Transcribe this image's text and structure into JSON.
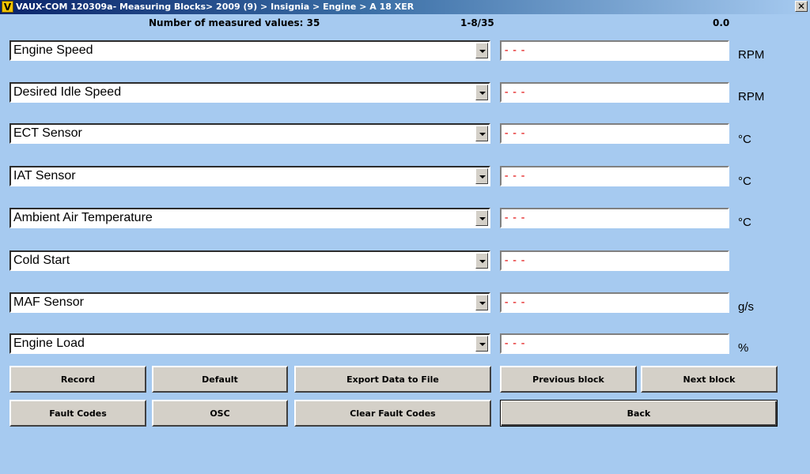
{
  "window": {
    "icon_letter": "V",
    "title": "VAUX-COM 120309a- Measuring Blocks> 2009 (9) > Insignia > Engine > A 18 XER",
    "close_symbol": "✕"
  },
  "header": {
    "count_label": "Number of measured values: 35",
    "range": "1-8/35",
    "time": "0.0"
  },
  "rows": [
    {
      "name": "Engine Speed",
      "value": "---",
      "unit": "RPM"
    },
    {
      "name": "Desired Idle Speed",
      "value": "---",
      "unit": "RPM"
    },
    {
      "name": "ECT Sensor",
      "value": "---",
      "unit": "°C"
    },
    {
      "name": "IAT Sensor",
      "value": "---",
      "unit": "°C"
    },
    {
      "name": "Ambient Air Temperature",
      "value": "---",
      "unit": "°C"
    },
    {
      "name": "Cold Start",
      "value": "---",
      "unit": ""
    },
    {
      "name": "MAF Sensor",
      "value": "---",
      "unit": "g/s"
    },
    {
      "name": "Engine Load",
      "value": "---",
      "unit": "%"
    }
  ],
  "buttons": {
    "record": "Record",
    "default": "Default",
    "export": "Export Data to File",
    "previous_block": "Previous block",
    "next_block": "Next block",
    "fault_codes": "Fault Codes",
    "osc": "OSC",
    "clear_fault_codes": "Clear Fault Codes",
    "back": "Back"
  },
  "colors": {
    "background": "#a6caf0",
    "value_text": "#e00000",
    "button_face": "#d4d0c8"
  }
}
